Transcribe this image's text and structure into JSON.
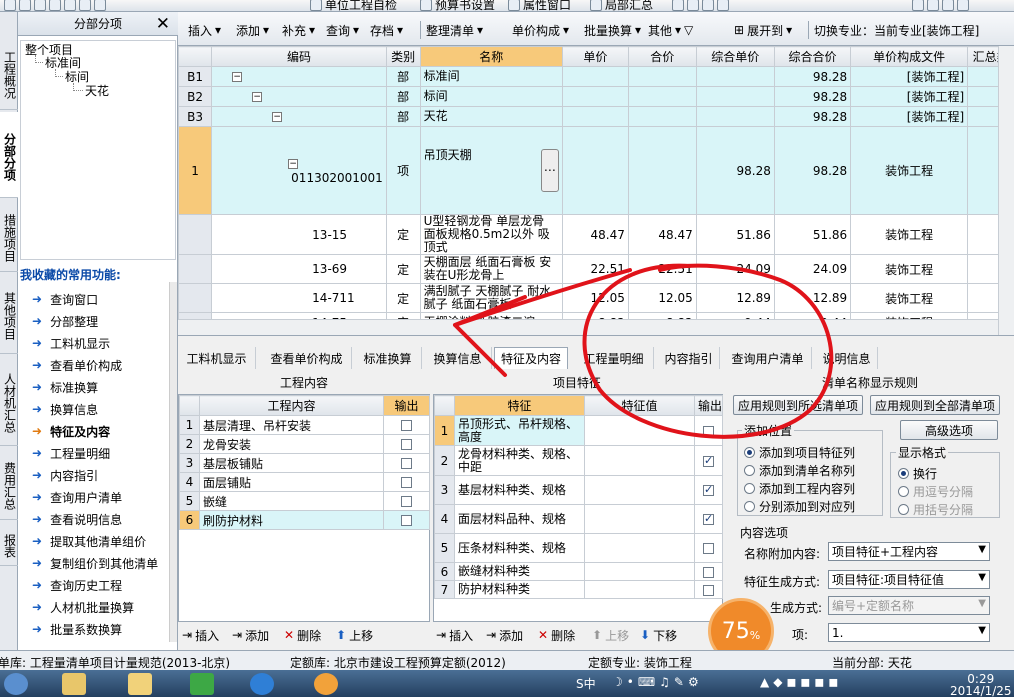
{
  "top_toolbar": {
    "items": [
      "单位工程自检",
      "预算书设置",
      "属性窗口",
      "局部汇总"
    ]
  },
  "vtabs": [
    {
      "label": "工程概况"
    },
    {
      "label": "分部分项"
    },
    {
      "label": "措施项目"
    },
    {
      "label": "其他项目"
    },
    {
      "label": "人材机汇总"
    },
    {
      "label": "费用汇总"
    },
    {
      "label": "报表"
    }
  ],
  "left_panel": {
    "title": "分部分项",
    "tree": [
      "整个项目",
      "标准间",
      "标间",
      "天花"
    ],
    "fav_title": "我收藏的常用功能:",
    "fav_items": [
      "查询窗口",
      "分部整理",
      "工料机显示",
      "查看单价构成",
      "标准换算",
      "换算信息",
      "特征及内容",
      "工程量明细",
      "内容指引",
      "查询用户清单",
      "查看说明信息",
      "提取其他清单组价",
      "复制组价到其他清单",
      "查询历史工程",
      "人材机批量换算",
      "批量系数换算"
    ]
  },
  "main_toolbar": {
    "buttons": [
      "插入",
      "添加",
      "补充",
      "查询",
      "存档",
      "整理清单",
      "单价构成",
      "批量换算",
      "其他",
      "展开到"
    ],
    "major": "切换专业：当前专业[装饰工程]"
  },
  "grid": {
    "headers": [
      "编码",
      "类别",
      "名称",
      "单价",
      "合价",
      "综合单价",
      "综合合价",
      "单价构成文件",
      "汇总类"
    ],
    "rows": [
      {
        "rh": "B1",
        "code": "",
        "type": "部",
        "name": "标准间",
        "price": "",
        "total": "",
        "cprice": "",
        "ctotal": "98.28",
        "file": "[装饰工程]"
      },
      {
        "rh": "B2",
        "code": "",
        "type": "部",
        "name": "标间",
        "price": "",
        "total": "",
        "cprice": "",
        "ctotal": "98.28",
        "file": "[装饰工程]"
      },
      {
        "rh": "B3",
        "code": "",
        "type": "部",
        "name": "天花",
        "price": "",
        "total": "",
        "cprice": "",
        "ctotal": "98.28",
        "file": "[装饰工程]"
      },
      {
        "rh": "1",
        "code": "011302001001",
        "type": "项",
        "name": "吊顶天棚",
        "price": "",
        "total": "",
        "cprice": "98.28",
        "ctotal": "98.28",
        "file": "装饰工程"
      },
      {
        "rh": "",
        "code": "13-15",
        "type": "定",
        "name": "U型轻钢龙骨 单层龙骨 面板规格0.5m2以外 吸顶式",
        "price": "48.47",
        "total": "48.47",
        "cprice": "51.86",
        "ctotal": "51.86",
        "file": "装饰工程"
      },
      {
        "rh": "",
        "code": "13-69",
        "type": "定",
        "name": "天棚面层 纸面石膏板 安装在U形龙骨上",
        "price": "22.51",
        "total": "22.51",
        "cprice": "24.09",
        "ctotal": "24.09",
        "file": "装饰工程"
      },
      {
        "rh": "",
        "code": "14-711",
        "type": "定",
        "name": "满刮腻子 天棚腻子 耐水腻子 纸面石膏板",
        "price": "12.05",
        "total": "12.05",
        "cprice": "12.89",
        "ctotal": "12.89",
        "file": "装饰工程"
      },
      {
        "rh": "",
        "code": "14-75",
        "type": "定",
        "name": "天棚涂料 乳胶漆二遍",
        "price": "8.82",
        "total": "8.82",
        "cprice": "9.44",
        "ctotal": "9.44",
        "file": "装饰工程"
      }
    ]
  },
  "bottom_tabs": [
    "工料机显示",
    "查看单价构成",
    "标准换算",
    "换算信息",
    "特征及内容",
    "工程量明细",
    "内容指引",
    "查询用户清单",
    "说明信息"
  ],
  "work_content": {
    "title": "工程内容",
    "col_content": "工程内容",
    "col_output": "输出",
    "rows": [
      {
        "n": "1",
        "text": "基层清理、吊杆安装"
      },
      {
        "n": "2",
        "text": "龙骨安装"
      },
      {
        "n": "3",
        "text": "基层板铺贴"
      },
      {
        "n": "4",
        "text": "面层铺贴"
      },
      {
        "n": "5",
        "text": "嵌缝"
      },
      {
        "n": "6",
        "text": "刷防护材料"
      }
    ],
    "insert": "插入",
    "add": "添加",
    "delete": "删除",
    "up": "上移"
  },
  "features": {
    "title": "项目特征",
    "col_feature": "特征",
    "col_value": "特征值",
    "col_output": "输出",
    "rows": [
      {
        "n": "1",
        "text": "吊顶形式、吊杆规格、高度",
        "checked": false
      },
      {
        "n": "2",
        "text": "龙骨材料种类、规格、中距",
        "checked": true
      },
      {
        "n": "3",
        "text": "基层材料种类、规格",
        "checked": true
      },
      {
        "n": "4",
        "text": "面层材料品种、规格",
        "checked": true
      },
      {
        "n": "5",
        "text": "压条材料种类、规格",
        "checked": false
      },
      {
        "n": "6",
        "text": "嵌缝材料种类",
        "checked": false
      },
      {
        "n": "7",
        "text": "防护材料种类",
        "checked": false
      }
    ],
    "insert": "插入",
    "add": "添加",
    "delete": "删除",
    "up": "上移",
    "down": "下移"
  },
  "rules": {
    "title": "清单名称显示规则",
    "apply_selected": "应用规则到所选清单项",
    "apply_all": "应用规则到全部清单项",
    "advanced": "高级选项",
    "add_pos_legend": "添加位置",
    "add_pos": [
      "添加到项目特征列",
      "添加到清单名称列",
      "添加到工程内容列",
      "分别添加到对应列"
    ],
    "display_legend": "显示格式",
    "display": [
      "换行",
      "用逗号分隔",
      "用括号分隔"
    ],
    "content_opts_title": "内容选项",
    "name_append_label": "名称附加内容:",
    "name_append_value": "项目特征+工程内容",
    "feat_gen_label": "特征生成方式:",
    "feat_gen_value": "项目特征:项目特征值",
    "sub_gen_label": "生成方式:",
    "sub_gen_value": "编号+定额名称",
    "num_label": "项:",
    "num_value": "1."
  },
  "status": {
    "list_lib": "单库: 工程量清单项目计量规范(2013-北京)",
    "quota_lib": "定额库: 北京市建设工程预算定额(2012)",
    "quota_major": "定额专业: 装饰工程",
    "current_section": "当前分部: 天花"
  },
  "progress": {
    "value": 75,
    "unit": "%"
  },
  "taskbar": {
    "time": "0:29",
    "date": "2014/1/25",
    "ime": "S中"
  }
}
